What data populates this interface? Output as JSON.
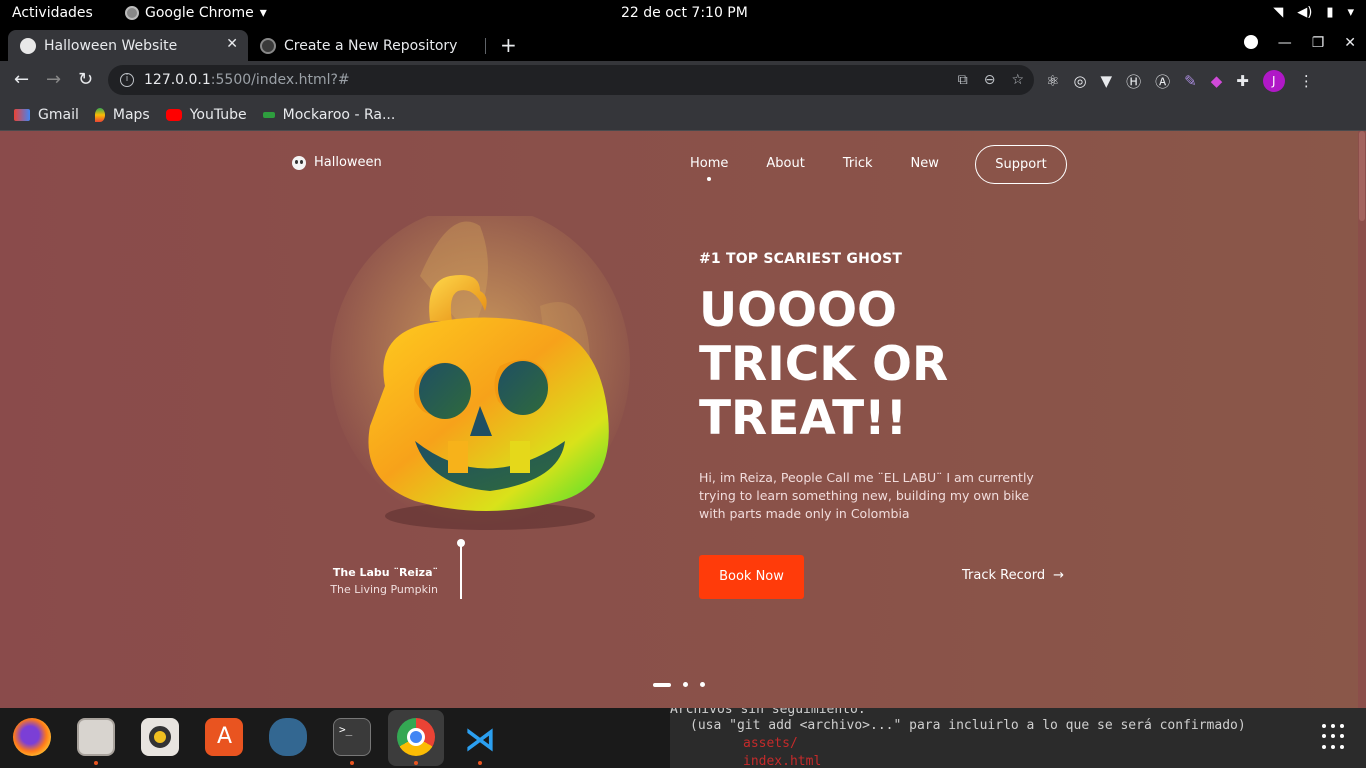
{
  "system": {
    "activities": "Actividades",
    "app_name": "Google Chrome",
    "clock": "22 de oct   7:10 PM"
  },
  "tabs": [
    {
      "title": "Halloween Website",
      "active": true
    },
    {
      "title": "Create a New Repository",
      "active": false
    }
  ],
  "omnibox": {
    "host": "127.0.0.1",
    "rest": ":5500/index.html?#"
  },
  "profile": {
    "initial": "J"
  },
  "bookmarks": [
    {
      "label": "Gmail"
    },
    {
      "label": "Maps"
    },
    {
      "label": "YouTube"
    },
    {
      "label": "Mockaroo - Ra..."
    }
  ],
  "site": {
    "logo": "Halloween",
    "nav": [
      "Home",
      "About",
      "Trick",
      "New"
    ],
    "support": "Support",
    "kicker": "#1 TOP SCARIEST GHOST",
    "headline": [
      "UOOOO",
      "TRICK OR",
      "TREAT!!"
    ],
    "description": "Hi, im Reiza, People Call me ¨EL LABU¨ I am currently trying to learn something new, building my own bike with parts made only in Colombia",
    "book_button": "Book Now",
    "track_link": "Track Record",
    "caption_name": "The Labu ¨Reiza¨",
    "caption_sub": "The Living Pumpkin"
  },
  "terminal": {
    "line1": "Archivos sin seguimiento:",
    "line2": "(usa \"git add <archivo>...\" para incluirlo a lo que se será confirmado)",
    "line3": "assets/",
    "line4": "index.html"
  },
  "colors": {
    "page_bg": "#8a4e4a",
    "accent": "#ff3b0a",
    "chrome_dark": "#35363a"
  }
}
